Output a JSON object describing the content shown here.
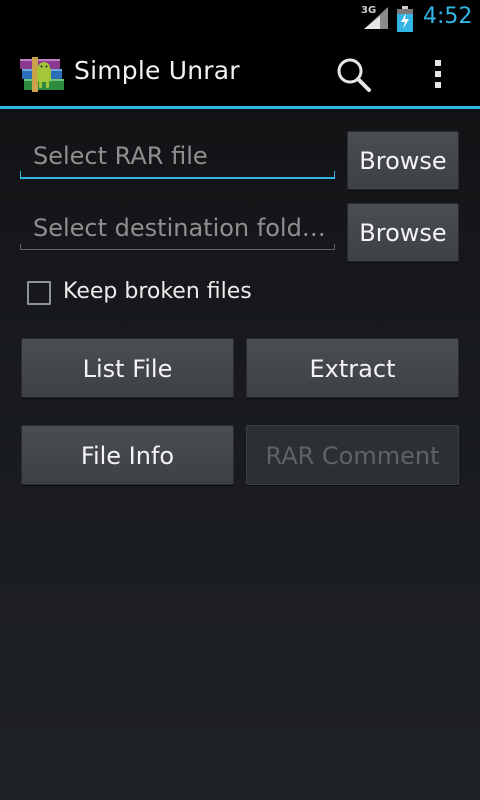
{
  "status_bar": {
    "network_type": "3G",
    "time": "4:52"
  },
  "action_bar": {
    "app_title": "Simple Unrar",
    "icons": [
      "winrar-app-icon",
      "search-icon",
      "overflow-menu-icon"
    ]
  },
  "form": {
    "rar_file": {
      "value": "",
      "placeholder": "Select RAR file",
      "focused": true
    },
    "destination": {
      "value": "",
      "placeholder": "Select destination fold…"
    },
    "browse_label": "Browse",
    "keep_broken": {
      "label": "Keep broken files",
      "checked": false
    }
  },
  "actions": {
    "list_file": "List File",
    "extract": "Extract",
    "file_info": "File Info",
    "rar_comment": "RAR Comment",
    "rar_comment_enabled": false
  },
  "colors": {
    "accent": "#33b5e5",
    "background": "#1c1e21",
    "button": "#43464a"
  }
}
